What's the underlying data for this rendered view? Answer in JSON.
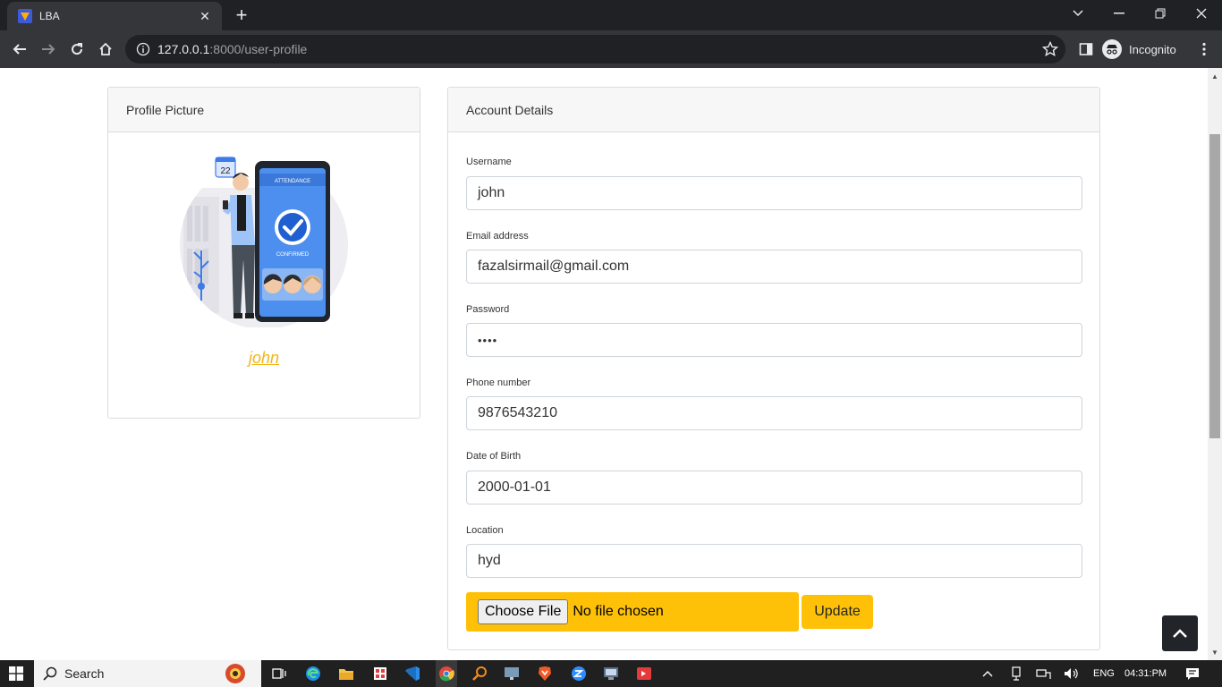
{
  "browser": {
    "tab_title": "LBA",
    "url_host": "127.0.0.1",
    "url_rest": ":8000/user-profile",
    "profile_label": "Incognito"
  },
  "profile_card": {
    "header": "Profile Picture",
    "username_link": "john",
    "illustration_text": {
      "title": "ATTENDANCE",
      "status": "CONFIRMED",
      "calendar_day": "22"
    }
  },
  "account_card": {
    "header": "Account Details",
    "fields": [
      {
        "label": "Username",
        "value": "john"
      },
      {
        "label": "Email address",
        "value": "fazalsirmail@gmail.com"
      },
      {
        "label": "Password",
        "value": "••••"
      },
      {
        "label": "Phone number",
        "value": "9876543210"
      },
      {
        "label": "Date of Birth",
        "value": "2000-01-01"
      },
      {
        "label": "Location",
        "value": "hyd"
      }
    ],
    "file_button": "Choose File",
    "file_status": "No file chosen",
    "update_button": "Update"
  },
  "taskbar": {
    "search_text": "Search",
    "language": "ENG",
    "time": "04:31:PM"
  },
  "colors": {
    "accent": "#ffc107",
    "link": "#f4b41a",
    "dark": "#212529"
  }
}
